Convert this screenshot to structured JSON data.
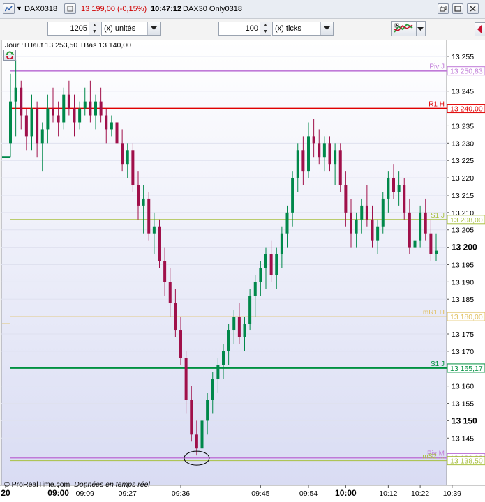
{
  "window": {
    "instrument": "DAX0318",
    "price_change": "13 199,00 (-0,15%)",
    "time": "10:47:12",
    "product": "DAX30 Only0318"
  },
  "toolbar": {
    "units_value": "1205",
    "units_label": "(x) unités",
    "ticks_value": "100",
    "ticks_label": "(x) ticks"
  },
  "chart_header": "Jour :+Haut 13 253,50 +Bas 13 140,00",
  "footer": {
    "brand": "© ProRealTime.com",
    "realtime": "Données en temps réel"
  },
  "colors": {
    "bull": "#00884a",
    "bear": "#a0104a",
    "piv": "#c07ad8",
    "r1": "#e00000",
    "s1j": "#a8c040",
    "mr1": "#e0c060",
    "s1": "#009040",
    "pivm": "#c07ad8",
    "ms": "#a8c040"
  },
  "chart_data": {
    "type": "candlestick",
    "y_range": [
      13133,
      13258
    ],
    "y_ticks": [
      {
        "v": 13255,
        "label": "13 255",
        "bold": false
      },
      {
        "v": 13245,
        "label": "13 245",
        "bold": false
      },
      {
        "v": 13235,
        "label": "13 235",
        "bold": false
      },
      {
        "v": 13230,
        "label": "13 230",
        "bold": false
      },
      {
        "v": 13225,
        "label": "13 225",
        "bold": false
      },
      {
        "v": 13220,
        "label": "13 220",
        "bold": false
      },
      {
        "v": 13215,
        "label": "13 215",
        "bold": false
      },
      {
        "v": 13210,
        "label": "13 210",
        "bold": false
      },
      {
        "v": 13205,
        "label": "13 205",
        "bold": false
      },
      {
        "v": 13200,
        "label": "13 200",
        "bold": true
      },
      {
        "v": 13195,
        "label": "13 195",
        "bold": false
      },
      {
        "v": 13190,
        "label": "13 190",
        "bold": false
      },
      {
        "v": 13185,
        "label": "13 185",
        "bold": false
      },
      {
        "v": 13175,
        "label": "13 175",
        "bold": false
      },
      {
        "v": 13170,
        "label": "13 170",
        "bold": false
      },
      {
        "v": 13160,
        "label": "13 160",
        "bold": false
      },
      {
        "v": 13155,
        "label": "13 155",
        "bold": false
      },
      {
        "v": 13150,
        "label": "13 150",
        "bold": true
      },
      {
        "v": 13145,
        "label": "13 145",
        "bold": false
      }
    ],
    "x_ticks": [
      {
        "i": 0,
        "label": "20",
        "bold": true
      },
      {
        "i": 9,
        "label": "09:00",
        "bold": true
      },
      {
        "i": 14,
        "label": "09:09",
        "bold": false
      },
      {
        "i": 22,
        "label": "09:27",
        "bold": false
      },
      {
        "i": 32,
        "label": "09:36",
        "bold": false
      },
      {
        "i": 47,
        "label": "09:45",
        "bold": false
      },
      {
        "i": 56,
        "label": "09:54",
        "bold": false
      },
      {
        "i": 63,
        "label": "10:00",
        "bold": true
      },
      {
        "i": 71,
        "label": "10:12",
        "bold": false
      },
      {
        "i": 77,
        "label": "10:22",
        "bold": false
      },
      {
        "i": 83,
        "label": "10:39",
        "bold": false
      }
    ],
    "levels": [
      {
        "name": "Piv J",
        "value": 13250.83,
        "label": "13 250,83",
        "colorKey": "piv",
        "width": 2
      },
      {
        "name": "R1 H",
        "value": 13240.0,
        "label": "13 240,00",
        "colorKey": "r1",
        "width": 2
      },
      {
        "name": "S1 J",
        "value": 13208.0,
        "label": "13 208,00",
        "colorKey": "s1j",
        "width": 1
      },
      {
        "name": "mR1 H",
        "value": 13180.0,
        "label": "13 180,00",
        "colorKey": "mr1",
        "width": 1
      },
      {
        "name": "S1 J",
        "value": 13165.17,
        "label": "13 165,17",
        "colorKey": "s1",
        "width": 2
      },
      {
        "name": "Piv M",
        "value": 13139.33,
        "label": "13 139,33",
        "colorKey": "pivm",
        "width": 2
      },
      {
        "name": "mS2 ...",
        "value": 13138.5,
        "label": "13 138,50",
        "colorKey": "ms",
        "width": 1
      }
    ],
    "candles": [
      [
        13230,
        13250,
        13226,
        13242
      ],
      [
        13242,
        13254,
        13232,
        13246
      ],
      [
        13246,
        13248,
        13234,
        13238
      ],
      [
        13238,
        13240,
        13228,
        13232
      ],
      [
        13232,
        13244,
        13228,
        13240
      ],
      [
        13240,
        13242,
        13226,
        13230
      ],
      [
        13230,
        13236,
        13222,
        13234
      ],
      [
        13234,
        13244,
        13230,
        13240
      ],
      [
        13240,
        13246,
        13236,
        13238
      ],
      [
        13238,
        13242,
        13232,
        13236
      ],
      [
        13236,
        13246,
        13234,
        13244
      ],
      [
        13244,
        13248,
        13238,
        13240
      ],
      [
        13240,
        13244,
        13232,
        13236
      ],
      [
        13236,
        13242,
        13234,
        13240
      ],
      [
        13240,
        13246,
        13238,
        13242
      ],
      [
        13242,
        13248,
        13236,
        13238
      ],
      [
        13238,
        13244,
        13234,
        13242
      ],
      [
        13242,
        13246,
        13236,
        13238
      ],
      [
        13238,
        13240,
        13230,
        13234
      ],
      [
        13234,
        13238,
        13232,
        13236
      ],
      [
        13236,
        13238,
        13228,
        13230
      ],
      [
        13230,
        13234,
        13222,
        13224
      ],
      [
        13224,
        13230,
        13220,
        13228
      ],
      [
        13228,
        13230,
        13216,
        13218
      ],
      [
        13218,
        13222,
        13208,
        13212
      ],
      [
        13212,
        13218,
        13204,
        13214
      ],
      [
        13214,
        13216,
        13202,
        13204
      ],
      [
        13204,
        13210,
        13198,
        13206
      ],
      [
        13206,
        13208,
        13194,
        13196
      ],
      [
        13196,
        13200,
        13186,
        13190
      ],
      [
        13190,
        13194,
        13180,
        13184
      ],
      [
        13184,
        13188,
        13174,
        13176
      ],
      [
        13176,
        13180,
        13166,
        13168
      ],
      [
        13168,
        13170,
        13152,
        13156
      ],
      [
        13156,
        13160,
        13144,
        13146
      ],
      [
        13146,
        13150,
        13140,
        13142
      ],
      [
        13142,
        13152,
        13140,
        13150
      ],
      [
        13150,
        13158,
        13146,
        13156
      ],
      [
        13156,
        13164,
        13152,
        13162
      ],
      [
        13162,
        13168,
        13158,
        13166
      ],
      [
        13166,
        13172,
        13162,
        13170
      ],
      [
        13170,
        13178,
        13166,
        13176
      ],
      [
        13176,
        13182,
        13172,
        13180
      ],
      [
        13180,
        13184,
        13172,
        13174
      ],
      [
        13174,
        13180,
        13170,
        13178
      ],
      [
        13178,
        13188,
        13176,
        13186
      ],
      [
        13186,
        13192,
        13180,
        13190
      ],
      [
        13190,
        13196,
        13186,
        13194
      ],
      [
        13194,
        13200,
        13188,
        13198
      ],
      [
        13198,
        13202,
        13190,
        13192
      ],
      [
        13192,
        13200,
        13188,
        13198
      ],
      [
        13198,
        13206,
        13194,
        13204
      ],
      [
        13204,
        13212,
        13200,
        13210
      ],
      [
        13210,
        13222,
        13206,
        13220
      ],
      [
        13220,
        13230,
        13216,
        13228
      ],
      [
        13228,
        13232,
        13218,
        13222
      ],
      [
        13222,
        13236,
        13220,
        13232
      ],
      [
        13232,
        13237,
        13226,
        13230
      ],
      [
        13230,
        13234,
        13224,
        13226
      ],
      [
        13226,
        13232,
        13222,
        13230
      ],
      [
        13230,
        13232,
        13222,
        13224
      ],
      [
        13224,
        13230,
        13218,
        13228
      ],
      [
        13228,
        13230,
        13216,
        13218
      ],
      [
        13218,
        13222,
        13206,
        13210
      ],
      [
        13210,
        13214,
        13200,
        13204
      ],
      [
        13204,
        13210,
        13200,
        13208
      ],
      [
        13208,
        13214,
        13204,
        13212
      ],
      [
        13212,
        13218,
        13206,
        13208
      ],
      [
        13208,
        13212,
        13200,
        13202
      ],
      [
        13202,
        13208,
        13198,
        13206
      ],
      [
        13206,
        13216,
        13204,
        13214
      ],
      [
        13214,
        13222,
        13210,
        13220
      ],
      [
        13220,
        13224,
        13214,
        13216
      ],
      [
        13216,
        13222,
        13212,
        13218
      ],
      [
        13218,
        13220,
        13208,
        13210
      ],
      [
        13210,
        13214,
        13198,
        13200
      ],
      [
        13200,
        13204,
        13196,
        13202
      ],
      [
        13202,
        13212,
        13200,
        13210
      ],
      [
        13210,
        13214,
        13202,
        13204
      ],
      [
        13204,
        13208,
        13196,
        13198
      ],
      [
        13198,
        13204,
        13196,
        13199
      ]
    ]
  }
}
